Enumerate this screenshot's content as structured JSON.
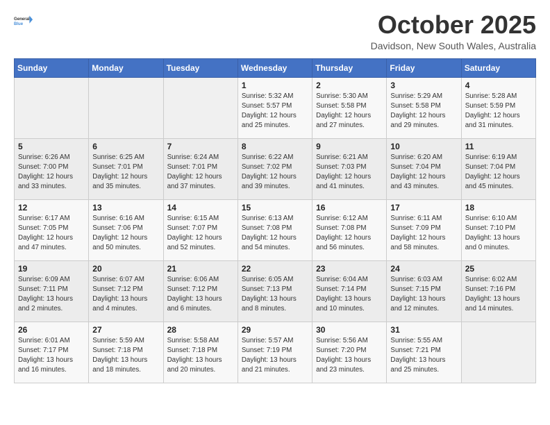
{
  "logo": {
    "line1": "General",
    "line2": "Blue"
  },
  "title": "October 2025",
  "subtitle": "Davidson, New South Wales, Australia",
  "days_of_week": [
    "Sunday",
    "Monday",
    "Tuesday",
    "Wednesday",
    "Thursday",
    "Friday",
    "Saturday"
  ],
  "weeks": [
    [
      {
        "day": "",
        "info": ""
      },
      {
        "day": "",
        "info": ""
      },
      {
        "day": "",
        "info": ""
      },
      {
        "day": "1",
        "info": "Sunrise: 5:32 AM\nSunset: 5:57 PM\nDaylight: 12 hours\nand 25 minutes."
      },
      {
        "day": "2",
        "info": "Sunrise: 5:30 AM\nSunset: 5:58 PM\nDaylight: 12 hours\nand 27 minutes."
      },
      {
        "day": "3",
        "info": "Sunrise: 5:29 AM\nSunset: 5:58 PM\nDaylight: 12 hours\nand 29 minutes."
      },
      {
        "day": "4",
        "info": "Sunrise: 5:28 AM\nSunset: 5:59 PM\nDaylight: 12 hours\nand 31 minutes."
      }
    ],
    [
      {
        "day": "5",
        "info": "Sunrise: 6:26 AM\nSunset: 7:00 PM\nDaylight: 12 hours\nand 33 minutes."
      },
      {
        "day": "6",
        "info": "Sunrise: 6:25 AM\nSunset: 7:01 PM\nDaylight: 12 hours\nand 35 minutes."
      },
      {
        "day": "7",
        "info": "Sunrise: 6:24 AM\nSunset: 7:01 PM\nDaylight: 12 hours\nand 37 minutes."
      },
      {
        "day": "8",
        "info": "Sunrise: 6:22 AM\nSunset: 7:02 PM\nDaylight: 12 hours\nand 39 minutes."
      },
      {
        "day": "9",
        "info": "Sunrise: 6:21 AM\nSunset: 7:03 PM\nDaylight: 12 hours\nand 41 minutes."
      },
      {
        "day": "10",
        "info": "Sunrise: 6:20 AM\nSunset: 7:04 PM\nDaylight: 12 hours\nand 43 minutes."
      },
      {
        "day": "11",
        "info": "Sunrise: 6:19 AM\nSunset: 7:04 PM\nDaylight: 12 hours\nand 45 minutes."
      }
    ],
    [
      {
        "day": "12",
        "info": "Sunrise: 6:17 AM\nSunset: 7:05 PM\nDaylight: 12 hours\nand 47 minutes."
      },
      {
        "day": "13",
        "info": "Sunrise: 6:16 AM\nSunset: 7:06 PM\nDaylight: 12 hours\nand 50 minutes."
      },
      {
        "day": "14",
        "info": "Sunrise: 6:15 AM\nSunset: 7:07 PM\nDaylight: 12 hours\nand 52 minutes."
      },
      {
        "day": "15",
        "info": "Sunrise: 6:13 AM\nSunset: 7:08 PM\nDaylight: 12 hours\nand 54 minutes."
      },
      {
        "day": "16",
        "info": "Sunrise: 6:12 AM\nSunset: 7:08 PM\nDaylight: 12 hours\nand 56 minutes."
      },
      {
        "day": "17",
        "info": "Sunrise: 6:11 AM\nSunset: 7:09 PM\nDaylight: 12 hours\nand 58 minutes."
      },
      {
        "day": "18",
        "info": "Sunrise: 6:10 AM\nSunset: 7:10 PM\nDaylight: 13 hours\nand 0 minutes."
      }
    ],
    [
      {
        "day": "19",
        "info": "Sunrise: 6:09 AM\nSunset: 7:11 PM\nDaylight: 13 hours\nand 2 minutes."
      },
      {
        "day": "20",
        "info": "Sunrise: 6:07 AM\nSunset: 7:12 PM\nDaylight: 13 hours\nand 4 minutes."
      },
      {
        "day": "21",
        "info": "Sunrise: 6:06 AM\nSunset: 7:12 PM\nDaylight: 13 hours\nand 6 minutes."
      },
      {
        "day": "22",
        "info": "Sunrise: 6:05 AM\nSunset: 7:13 PM\nDaylight: 13 hours\nand 8 minutes."
      },
      {
        "day": "23",
        "info": "Sunrise: 6:04 AM\nSunset: 7:14 PM\nDaylight: 13 hours\nand 10 minutes."
      },
      {
        "day": "24",
        "info": "Sunrise: 6:03 AM\nSunset: 7:15 PM\nDaylight: 13 hours\nand 12 minutes."
      },
      {
        "day": "25",
        "info": "Sunrise: 6:02 AM\nSunset: 7:16 PM\nDaylight: 13 hours\nand 14 minutes."
      }
    ],
    [
      {
        "day": "26",
        "info": "Sunrise: 6:01 AM\nSunset: 7:17 PM\nDaylight: 13 hours\nand 16 minutes."
      },
      {
        "day": "27",
        "info": "Sunrise: 5:59 AM\nSunset: 7:18 PM\nDaylight: 13 hours\nand 18 minutes."
      },
      {
        "day": "28",
        "info": "Sunrise: 5:58 AM\nSunset: 7:18 PM\nDaylight: 13 hours\nand 20 minutes."
      },
      {
        "day": "29",
        "info": "Sunrise: 5:57 AM\nSunset: 7:19 PM\nDaylight: 13 hours\nand 21 minutes."
      },
      {
        "day": "30",
        "info": "Sunrise: 5:56 AM\nSunset: 7:20 PM\nDaylight: 13 hours\nand 23 minutes."
      },
      {
        "day": "31",
        "info": "Sunrise: 5:55 AM\nSunset: 7:21 PM\nDaylight: 13 hours\nand 25 minutes."
      },
      {
        "day": "",
        "info": ""
      }
    ]
  ]
}
